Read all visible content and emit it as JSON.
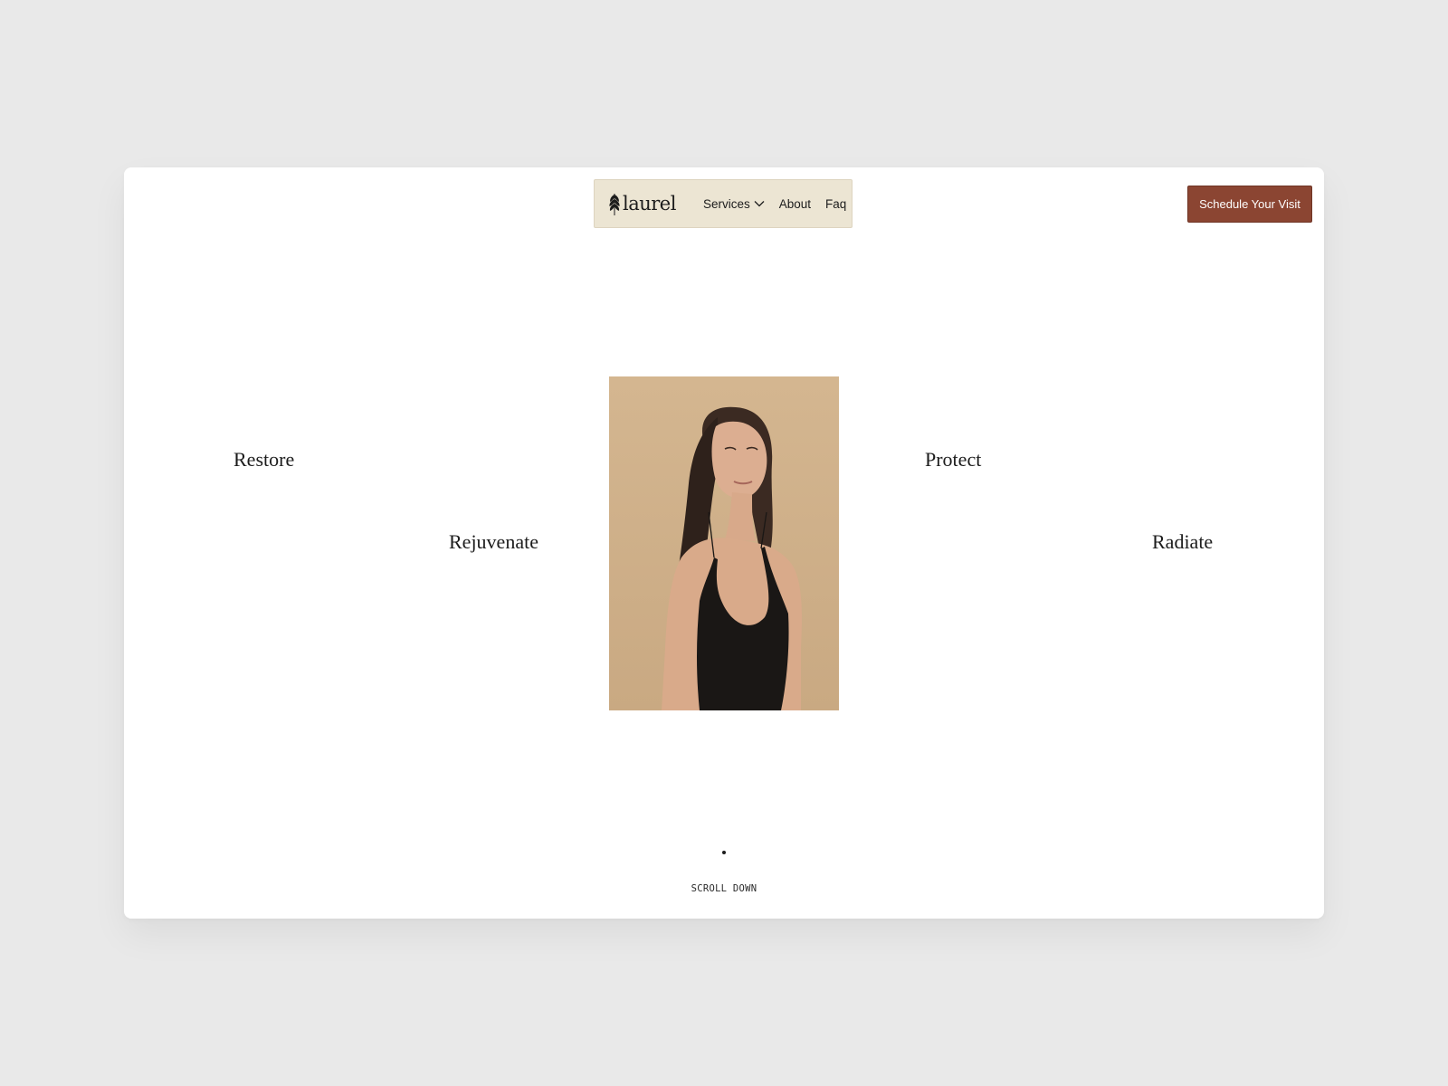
{
  "nav": {
    "logo_text": "laurel",
    "links": [
      {
        "label": "Services",
        "has_dropdown": true,
        "icon": "chevron-down-icon"
      },
      {
        "label": "About"
      },
      {
        "label": "Faq"
      }
    ]
  },
  "cta": {
    "label": "Schedule Your Visit",
    "color": "#8b4532"
  },
  "hero": {
    "words": [
      "Restore",
      "Rejuvenate",
      "Protect",
      "Radiate"
    ],
    "image_subject": "portrait-photo"
  },
  "footer": {
    "scroll_label": "SCROLL DOWN"
  },
  "colors": {
    "page_background": "#e9e9e9",
    "card_background": "#ffffff",
    "nav_background": "#ece5d3",
    "photo_background": "#d3b48e"
  }
}
